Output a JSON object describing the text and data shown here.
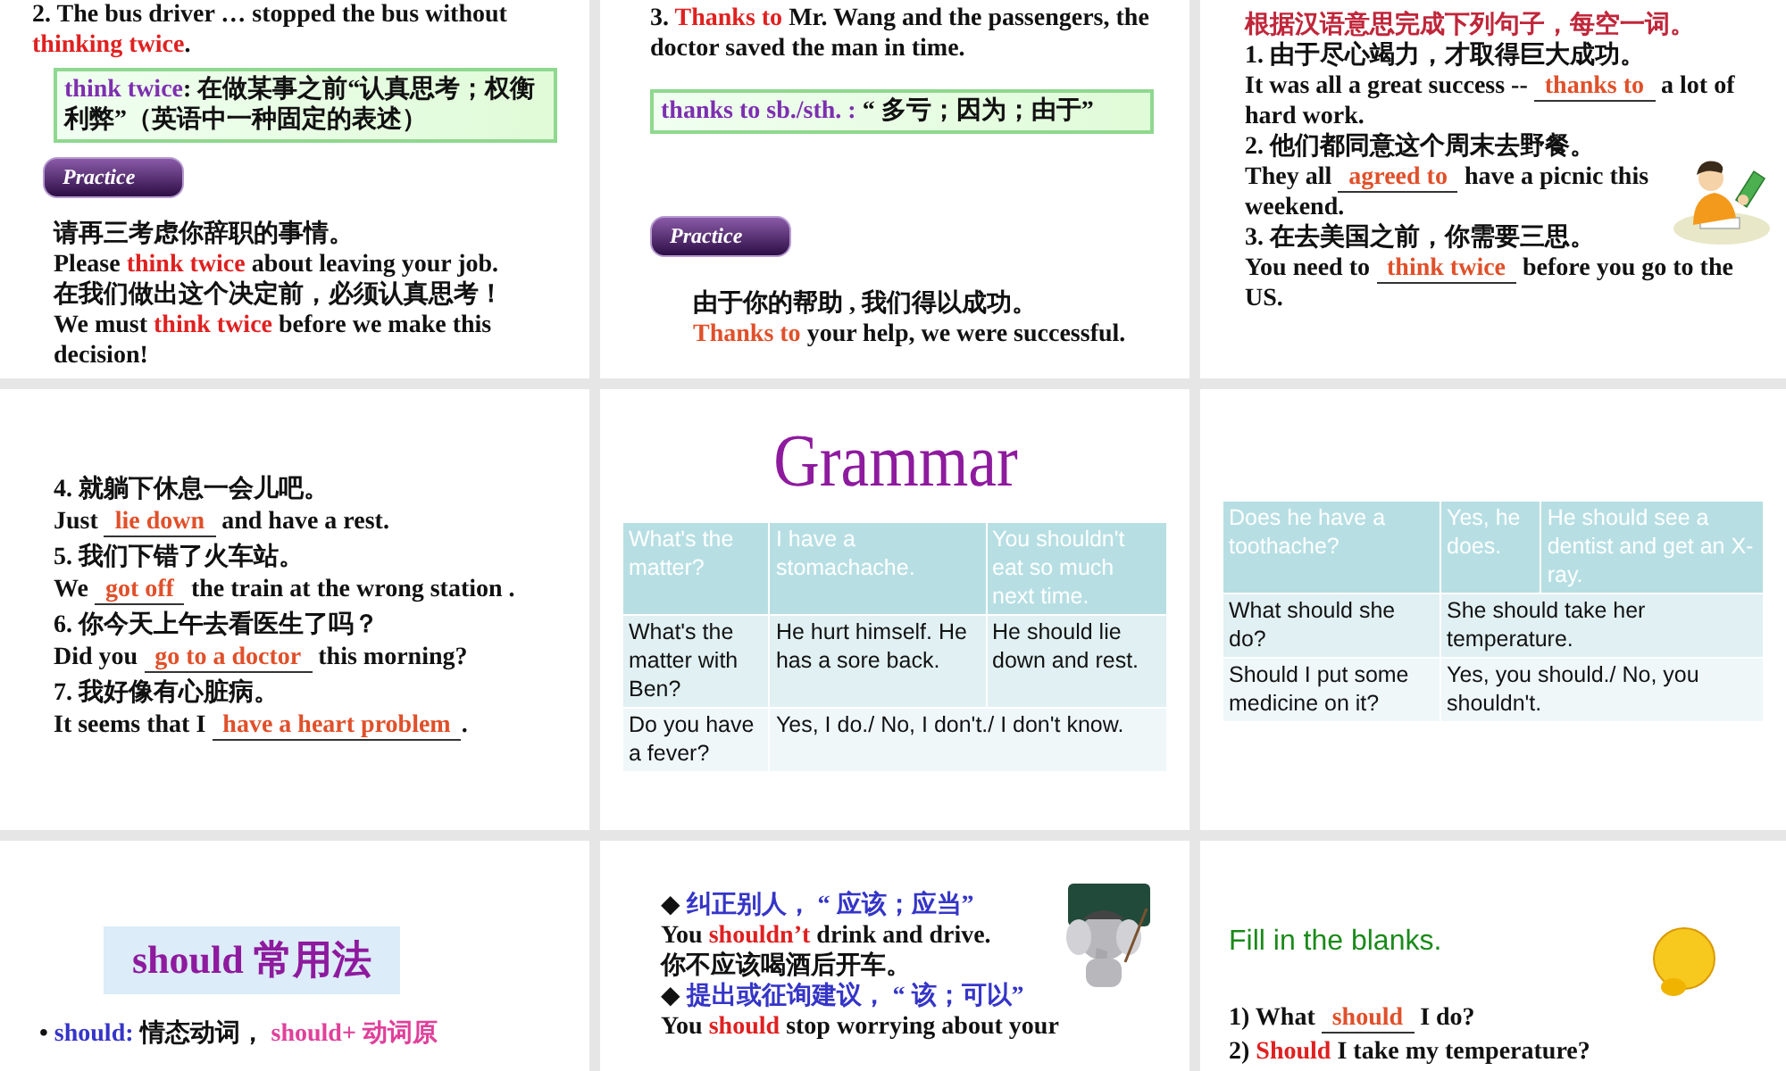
{
  "slides": [
    {
      "kind": "plain",
      "blocks": [
        {
          "kind": "text",
          "runs": [
            {
              "text": "2. The bus driver … stopped the bus without "
            },
            {
              "text": "thinking twice",
              "color": "#e02020"
            },
            {
              "text": "."
            }
          ]
        },
        {
          "kind": "definition",
          "runs": [
            {
              "text": "think twice",
              "color": "#7d2fb0"
            },
            {
              "text": ": 在做某事之前“认真思考；权衡利弊”（英语中一种固定的表述）"
            }
          ]
        },
        {
          "kind": "practice",
          "text": "Practice"
        },
        {
          "kind": "text",
          "runs": [
            {
              "text": "请再三考虑你辞职的事情。"
            }
          ]
        },
        {
          "kind": "text",
          "runs": [
            {
              "text": "Please "
            },
            {
              "text": "think twice",
              "color": "#e02020"
            },
            {
              "text": " about leaving your job."
            }
          ]
        },
        {
          "kind": "text",
          "runs": [
            {
              "text": "在我们做出这个决定前，必须认真思考！"
            }
          ]
        },
        {
          "kind": "text",
          "runs": [
            {
              "text": "We must "
            },
            {
              "text": "think twice",
              "color": "#e02020"
            },
            {
              "text": " before we make this decision!"
            }
          ]
        }
      ]
    },
    {
      "kind": "plain",
      "blocks": [
        {
          "kind": "text",
          "runs": [
            {
              "text": "3. "
            },
            {
              "text": "Thanks to",
              "color": "#e02020"
            },
            {
              "text": " Mr. Wang and the passengers, the doctor saved the man in time."
            }
          ]
        },
        {
          "kind": "definition",
          "runs": [
            {
              "text": "thanks to sb./sth. :",
              "color": "#7d2fb0"
            },
            {
              "text": " “ 多亏；因为；由于”"
            }
          ]
        },
        {
          "kind": "practice",
          "text": "Practice"
        },
        {
          "kind": "text",
          "runs": [
            {
              "text": "由于你的帮助 , 我们得以成功。"
            }
          ]
        },
        {
          "kind": "text",
          "runs": [
            {
              "text": "Thanks to",
              "color": "#e0502a"
            },
            {
              "text": " your help, we were successful."
            }
          ]
        }
      ]
    },
    {
      "kind": "reader",
      "blocks": [
        {
          "kind": "text",
          "runs": [
            {
              "text": "根据汉语意思完成下列句子，每空一词。",
              "color": "#c0263a"
            }
          ]
        },
        {
          "kind": "text",
          "runs": [
            {
              "text": "1.  由于尽心竭力，才取得巨大成功。"
            }
          ]
        },
        {
          "kind": "text",
          "runs": [
            {
              "text": "It was all a great success -- "
            },
            {
              "text": "thanks to",
              "kind": "blank"
            },
            {
              "text": " a lot of hard work."
            }
          ]
        },
        {
          "kind": "text",
          "runs": [
            {
              "text": "2.  他们都同意这个周末去野餐。"
            }
          ]
        },
        {
          "kind": "text",
          "runs": [
            {
              "text": "They all "
            },
            {
              "text": "agreed to",
              "kind": "blank"
            },
            {
              "text": " have a picnic this weekend."
            }
          ]
        },
        {
          "kind": "text",
          "runs": [
            {
              "text": "3.  在去美国之前，你需要三思。"
            }
          ]
        },
        {
          "kind": "text",
          "runs": [
            {
              "text": "You need to "
            },
            {
              "text": "think twice",
              "kind": "blank"
            },
            {
              "text": " before you go to the US."
            }
          ]
        }
      ]
    },
    {
      "kind": "plain",
      "blocks": [
        {
          "kind": "text",
          "runs": [
            {
              "text": "4.  就躺下休息一会儿吧。"
            }
          ]
        },
        {
          "kind": "text",
          "runs": [
            {
              "text": "Just "
            },
            {
              "text": "lie down",
              "kind": "blank"
            },
            {
              "text": " and have a rest."
            }
          ]
        },
        {
          "kind": "text",
          "runs": [
            {
              "text": "5.  我们下错了火车站。"
            }
          ]
        },
        {
          "kind": "text",
          "runs": [
            {
              "text": "We "
            },
            {
              "text": "got off",
              "kind": "blank"
            },
            {
              "text": " the train at the wrong station ."
            }
          ]
        },
        {
          "kind": "text",
          "runs": [
            {
              "text": "6.  你今天上午去看医生了吗？"
            }
          ]
        },
        {
          "kind": "text",
          "runs": [
            {
              "text": "Did you "
            },
            {
              "text": "go to a doctor",
              "kind": "blank"
            },
            {
              "text": " this morning?"
            }
          ]
        },
        {
          "kind": "text",
          "runs": [
            {
              "text": "7.  我好像有心脏病。"
            }
          ]
        },
        {
          "kind": "text",
          "runs": [
            {
              "text": "It seems that I "
            },
            {
              "text": "have a heart problem",
              "kind": "blank"
            },
            {
              "text": "."
            }
          ]
        }
      ]
    },
    {
      "kind": "plain",
      "blocks": [
        {
          "kind": "title",
          "text": "Grammar"
        },
        {
          "kind": "table",
          "rows": [
            [
              {
                "text": "What's the matter?"
              },
              {
                "text": "I have a stomachache."
              },
              {
                "text": "You shouldn't eat so much next time."
              }
            ],
            [
              {
                "text": "What's the matter with Ben?"
              },
              {
                "text": "He hurt himself. He has a sore back."
              },
              {
                "text": "He should lie down and rest."
              }
            ],
            [
              {
                "text": "Do you have a fever?"
              },
              {
                "text": "Yes, I do./ No, I don't./ I don't know.",
                "colspan": 2
              }
            ]
          ]
        }
      ]
    },
    {
      "kind": "plain",
      "blocks": [
        {
          "kind": "table",
          "rows": [
            [
              {
                "text": "Does he have a toothache?"
              },
              {
                "text": "Yes, he does."
              },
              {
                "text": "He should see a dentist and get an X-ray."
              }
            ],
            [
              {
                "text": "What should she do?"
              },
              {
                "text": "She should take her temperature.",
                "colspan": 2
              }
            ],
            [
              {
                "text": "Should I put some medicine on it?"
              },
              {
                "text": "Yes, you should./ No, you shouldn't.",
                "colspan": 2
              }
            ]
          ]
        }
      ]
    },
    {
      "kind": "plain",
      "blocks": [
        {
          "kind": "title-box",
          "text": "should  常用法"
        },
        {
          "kind": "text",
          "runs": [
            {
              "text": "• "
            },
            {
              "text": "should:",
              "color": "#3535c8"
            },
            {
              "text": " 情态动词，   "
            },
            {
              "text": "should+ 动词原",
              "color": "#e0409a"
            }
          ]
        }
      ]
    },
    {
      "kind": "elephant",
      "blocks": [
        {
          "kind": "text",
          "runs": [
            {
              "text": "◆ "
            },
            {
              "text": "纠正别人，  “ 应该；应当”",
              "color": "#3535c8"
            }
          ]
        },
        {
          "kind": "text",
          "runs": [
            {
              "text": "You "
            },
            {
              "text": "shouldn’t",
              "color": "#e02020"
            },
            {
              "text": " drink and drive."
            }
          ]
        },
        {
          "kind": "text",
          "runs": [
            {
              "text": "你不应该喝酒后开车。"
            }
          ]
        },
        {
          "kind": "text",
          "runs": [
            {
              "text": "◆ "
            },
            {
              "text": "提出或征询建议，  “ 该；可以”",
              "color": "#3535c8"
            }
          ]
        },
        {
          "kind": "text",
          "runs": [
            {
              "text": "You "
            },
            {
              "text": "should",
              "color": "#e02020"
            },
            {
              "text": " stop worrying about your"
            }
          ]
        }
      ]
    },
    {
      "kind": "face",
      "blocks": [
        {
          "kind": "heading",
          "text": "Fill in the blanks."
        },
        {
          "kind": "text",
          "runs": [
            {
              "text": "1) What "
            },
            {
              "text": "should",
              "kind": "blank"
            },
            {
              "text": " I do?"
            }
          ]
        },
        {
          "kind": "text",
          "runs": [
            {
              "text": "2) "
            },
            {
              "text": "Should",
              "color": "#e02020"
            },
            {
              "text": " I take my temperature?"
            }
          ]
        }
      ]
    }
  ]
}
